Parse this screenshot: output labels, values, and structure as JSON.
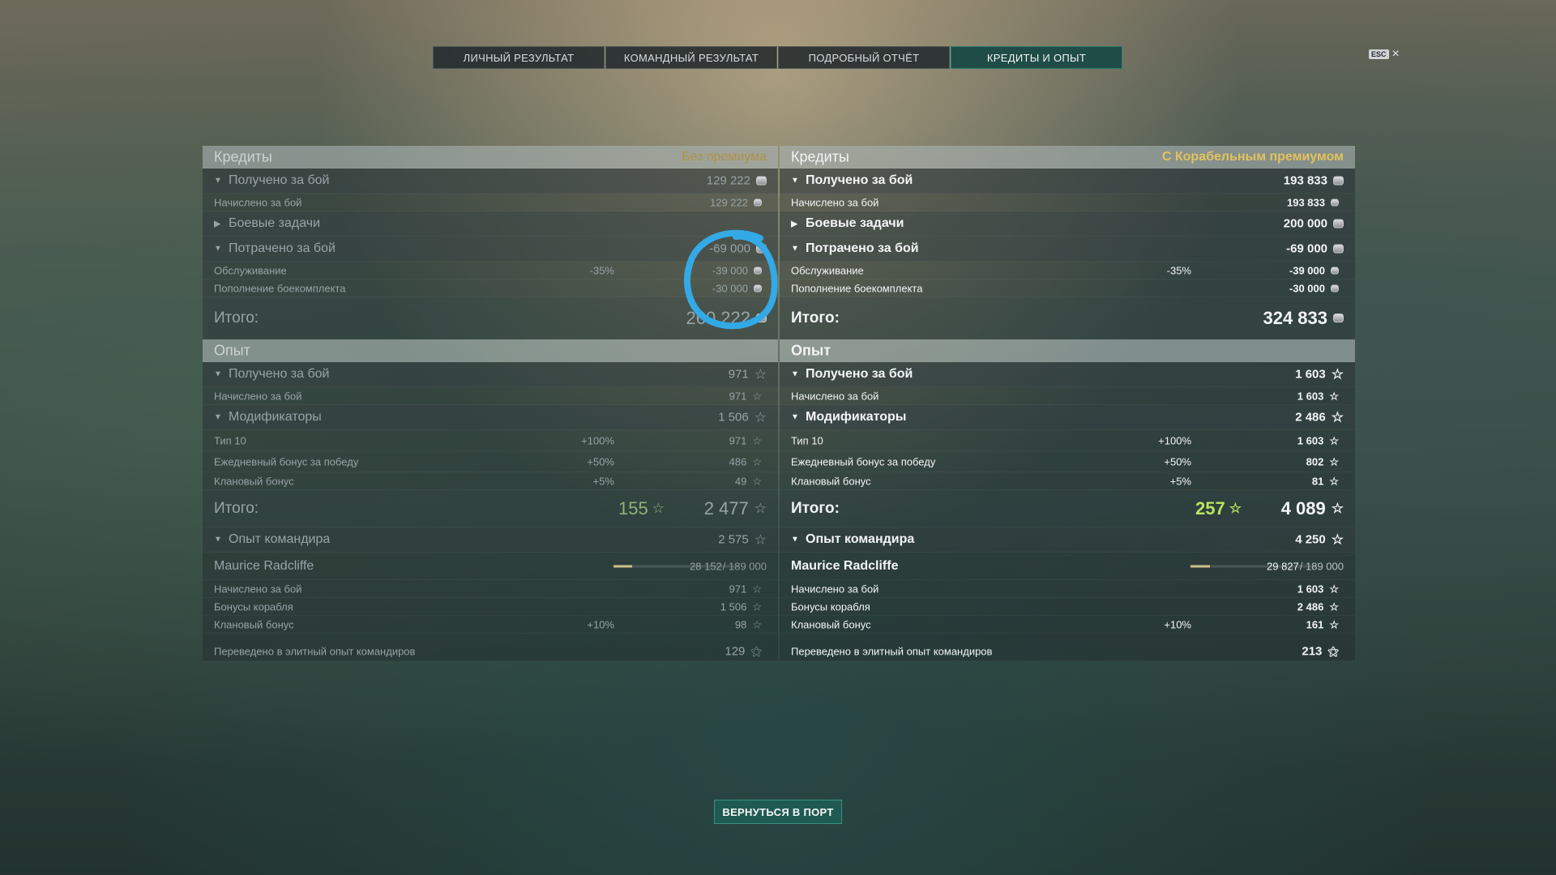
{
  "tabs": [
    "ЛИЧНЫЙ РЕЗУЛЬТАТ",
    "КОМАНДНЫЙ РЕЗУЛЬТАТ",
    "ПОДРОБНЫЙ ОТЧЁТ",
    "КРЕДИТЫ И ОПЫТ"
  ],
  "active_tab": "КРЕДИТЫ И ОПЫТ",
  "esc": {
    "key": "ESC",
    "close": "×"
  },
  "left": {
    "credits_title": "Кредиты",
    "credits_tag": "Без премиума",
    "earned_label": "Получено за бой",
    "earned_value": "129 222",
    "accrued_label": "Начислено за бой",
    "accrued_value": "129 222",
    "tasks_label": "Боевые задачи",
    "spent_label": "Потрачено за бой",
    "spent_value": "-69 000",
    "service_label": "Обслуживание",
    "service_pct": "-35%",
    "service_value": "-39 000",
    "ammo_label": "Пополнение боекомплекта",
    "ammo_value": "-30 000",
    "total_label": "Итого:",
    "credits_total": "260 222",
    "xp_title": "Опыт",
    "xp_earned_label": "Получено за бой",
    "xp_earned_value": "971",
    "xp_accrued_label": "Начислено за бой",
    "xp_accrued_value": "971",
    "modifiers_label": "Модификаторы",
    "modifiers_value": "1 506",
    "tier_label": "Тип 10",
    "tier_pct": "+100%",
    "tier_value": "971",
    "daily_label": "Ежедневный бонус за победу",
    "daily_pct": "+50%",
    "daily_value": "486",
    "clan_label": "Клановый бонус",
    "clan_pct": "+5%",
    "clan_value": "49",
    "xp_total_free": "155",
    "xp_total": "2 477",
    "cmd_label": "Опыт командира",
    "cmd_value": "2 575",
    "commander_name": "Maurice Radcliffe",
    "commander_xp": "28 152",
    "commander_xp_max": " / 189 000",
    "commander_progress": 0.149,
    "cmd_accrued_label": "Начислено за бой",
    "cmd_accrued_value": "971",
    "ship_bonus_label": "Бонусы корабля",
    "ship_bonus_value": "1 506",
    "cmd_clan_label": "Клановый бонус",
    "cmd_clan_pct": "+10%",
    "cmd_clan_value": "98",
    "elite_label": "Переведено в элитный опыт командиров",
    "elite_value": "129"
  },
  "right": {
    "credits_title": "Кредиты",
    "credits_tag": "С Корабельным премиумом",
    "earned_label": "Получено за бой",
    "earned_value": "193 833",
    "accrued_label": "Начислено за бой",
    "accrued_value": "193 833",
    "tasks_label": "Боевые задачи",
    "tasks_value": "200 000",
    "spent_label": "Потрачено за бой",
    "spent_value": "-69 000",
    "service_label": "Обслуживание",
    "service_pct": "-35%",
    "service_value": "-39 000",
    "ammo_label": "Пополнение боекомплекта",
    "ammo_value": "-30 000",
    "total_label": "Итого:",
    "credits_total": "324 833",
    "xp_title": "Опыт",
    "xp_earned_label": "Получено за бой",
    "xp_earned_value": "1 603",
    "xp_accrued_label": "Начислено за бой",
    "xp_accrued_value": "1 603",
    "modifiers_label": "Модификаторы",
    "modifiers_value": "2 486",
    "tier_label": "Тип 10",
    "tier_pct": "+100%",
    "tier_value": "1 603",
    "daily_label": "Ежедневный бонус за победу",
    "daily_pct": "+50%",
    "daily_value": "802",
    "clan_label": "Клановый бонус",
    "clan_pct": "+5%",
    "clan_value": "81",
    "xp_total_free": "257",
    "xp_total": "4 089",
    "cmd_label": "Опыт командира",
    "cmd_value": "4 250",
    "commander_name": "Maurice Radcliffe",
    "commander_xp": "29 827",
    "commander_xp_max": " / 189 000",
    "commander_progress": 0.158,
    "cmd_accrued_label": "Начислено за бой",
    "cmd_accrued_value": "1 603",
    "ship_bonus_label": "Бонусы корабля",
    "ship_bonus_value": "2 486",
    "cmd_clan_label": "Клановый бонус",
    "cmd_clan_pct": "+10%",
    "cmd_clan_value": "161",
    "elite_label": "Переведено в элитный опыт командиров",
    "elite_value": "213"
  },
  "return_button": "ВЕРНУТЬСЯ В ПОРТ",
  "annotation_color": "#33a9e6",
  "icons": [
    "coin-icon",
    "star-icon",
    "caret-down-icon",
    "caret-right-icon",
    "elite-xp-icon",
    "close-icon"
  ]
}
